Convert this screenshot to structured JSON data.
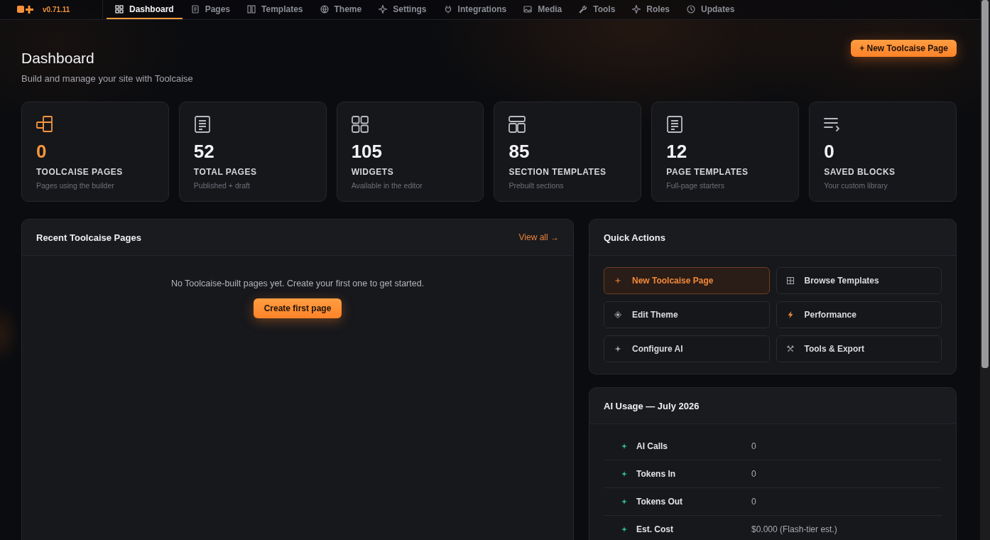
{
  "app": {
    "version": "v0.71.11"
  },
  "nav": {
    "tabs": [
      {
        "label": "Dashboard",
        "selected": true
      },
      {
        "label": "Pages",
        "selected": false
      },
      {
        "label": "Templates",
        "selected": false
      },
      {
        "label": "Theme",
        "selected": false
      },
      {
        "label": "Settings",
        "selected": false
      },
      {
        "label": "Integrations",
        "selected": false
      },
      {
        "label": "Media",
        "selected": false
      },
      {
        "label": "Tools",
        "selected": false
      },
      {
        "label": "Roles",
        "selected": false
      },
      {
        "label": "Updates",
        "selected": false
      }
    ]
  },
  "header": {
    "title": "Dashboard",
    "subtitle": "Build and manage your site with Toolcaise",
    "primary_button": "+ New Toolcaise Page"
  },
  "stats": [
    {
      "value": "0",
      "label": "TOOLCAISE PAGES",
      "caption": "Pages using the builder",
      "highlighted": true
    },
    {
      "value": "52",
      "label": "TOTAL PAGES",
      "caption": "Published + draft",
      "highlighted": false
    },
    {
      "value": "105",
      "label": "WIDGETS",
      "caption": "Available in the editor",
      "highlighted": false
    },
    {
      "value": "85",
      "label": "SECTION TEMPLATES",
      "caption": "Prebuilt sections",
      "highlighted": false
    },
    {
      "value": "12",
      "label": "PAGE TEMPLATES",
      "caption": "Full-page starters",
      "highlighted": false
    },
    {
      "value": "0",
      "label": "SAVED BLOCKS",
      "caption": "Your custom library",
      "highlighted": false
    }
  ],
  "recent_pages": {
    "title": "Recent Toolcaise Pages",
    "link": "View all →",
    "empty_message": "No Toolcaise-built pages yet. Create your first one to get started.",
    "button": "Create first page"
  },
  "quick_actions": {
    "title": "Quick Actions",
    "actions": [
      {
        "label": "New Toolcaise Page",
        "primary": true
      },
      {
        "label": "Browse Templates",
        "primary": false
      },
      {
        "label": "Edit Theme",
        "primary": false
      },
      {
        "label": "Performance",
        "primary": false
      },
      {
        "label": "Configure AI",
        "primary": false
      },
      {
        "label": "Tools & Export",
        "primary": false
      }
    ]
  },
  "ai_usage": {
    "title": "AI Usage — July 2026",
    "rows": [
      {
        "label": "AI Calls",
        "value": "0"
      },
      {
        "label": "Tokens In",
        "value": "0"
      },
      {
        "label": "Tokens Out",
        "value": "0"
      },
      {
        "label": "Est. Cost",
        "value": "$0.000 (Flash-tier est.)"
      }
    ]
  }
}
